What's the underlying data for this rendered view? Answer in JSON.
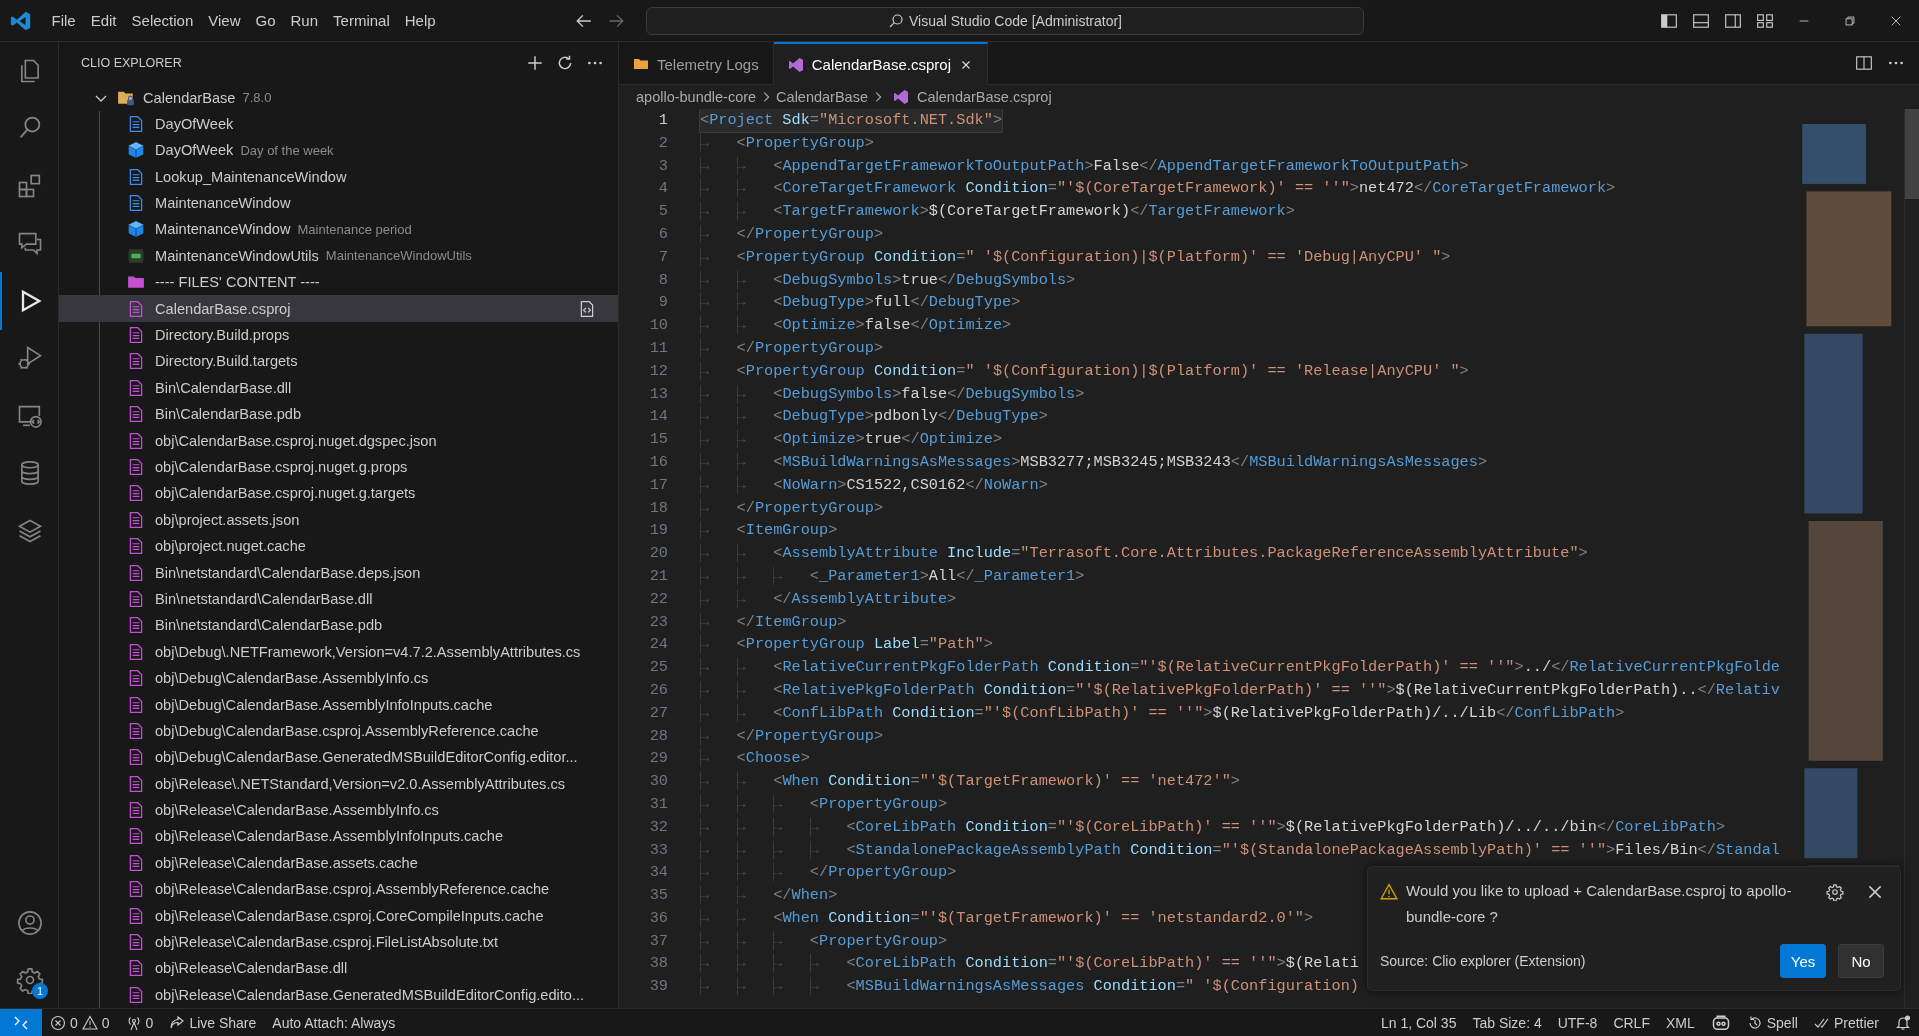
{
  "title_bar": {
    "menu": [
      "File",
      "Edit",
      "Selection",
      "View",
      "Go",
      "Run",
      "Terminal",
      "Help"
    ],
    "search": "Visual Studio Code [Administrator]"
  },
  "activity_bar": {
    "items": [
      {
        "kind": "files",
        "selected": false
      },
      {
        "kind": "search",
        "selected": false
      },
      {
        "kind": "extensions",
        "selected": false
      },
      {
        "kind": "chat",
        "selected": false
      },
      {
        "kind": "run",
        "selected": true
      },
      {
        "kind": "debug",
        "selected": false
      },
      {
        "kind": "remote",
        "selected": false
      },
      {
        "kind": "database",
        "selected": false
      },
      {
        "kind": "layers",
        "selected": false
      }
    ],
    "bottom": [
      {
        "kind": "account"
      },
      {
        "kind": "settings",
        "badge": "1"
      }
    ]
  },
  "sidebar": {
    "title": "CLIO EXPLORER",
    "tree": {
      "label": "CalendarBase",
      "description": "7.8.0",
      "expanded": true,
      "children": [
        {
          "kind": "doc",
          "label": "DayOfWeek",
          "selected": false
        },
        {
          "kind": "cube",
          "label": "DayOfWeek",
          "description": "Day of the week",
          "selected": false
        },
        {
          "kind": "doc",
          "label": "Lookup_MaintenanceWindow",
          "selected": false
        },
        {
          "kind": "doc",
          "label": "MaintenanceWindow",
          "selected": false
        },
        {
          "kind": "cube",
          "label": "MaintenanceWindow",
          "description": "Maintenance period",
          "selected": false
        },
        {
          "kind": "csharp",
          "label": "MaintenanceWindowUtils",
          "description": "MaintenanceWindowUtils",
          "selected": false
        },
        {
          "kind": "folder",
          "label": "---- FILES' CONTENT ----",
          "selected": false
        },
        {
          "kind": "file",
          "label": "CalendarBase.csproj",
          "selected": true
        },
        {
          "kind": "file",
          "label": "Directory.Build.props",
          "selected": false
        },
        {
          "kind": "file",
          "label": "Directory.Build.targets",
          "selected": false
        },
        {
          "kind": "file",
          "label": "Bin\\CalendarBase.dll",
          "selected": false
        },
        {
          "kind": "file",
          "label": "Bin\\CalendarBase.pdb",
          "selected": false
        },
        {
          "kind": "file",
          "label": "obj\\CalendarBase.csproj.nuget.dgspec.json",
          "selected": false
        },
        {
          "kind": "file",
          "label": "obj\\CalendarBase.csproj.nuget.g.props",
          "selected": false
        },
        {
          "kind": "file",
          "label": "obj\\CalendarBase.csproj.nuget.g.targets",
          "selected": false
        },
        {
          "kind": "file",
          "label": "obj\\project.assets.json",
          "selected": false
        },
        {
          "kind": "file",
          "label": "obj\\project.nuget.cache",
          "selected": false
        },
        {
          "kind": "file",
          "label": "Bin\\netstandard\\CalendarBase.deps.json",
          "selected": false
        },
        {
          "kind": "file",
          "label": "Bin\\netstandard\\CalendarBase.dll",
          "selected": false
        },
        {
          "kind": "file",
          "label": "Bin\\netstandard\\CalendarBase.pdb",
          "selected": false
        },
        {
          "kind": "file",
          "label": "obj\\Debug\\.NETFramework,Version=v4.7.2.AssemblyAttributes.cs",
          "selected": false
        },
        {
          "kind": "file",
          "label": "obj\\Debug\\CalendarBase.AssemblyInfo.cs",
          "selected": false
        },
        {
          "kind": "file",
          "label": "obj\\Debug\\CalendarBase.AssemblyInfoInputs.cache",
          "selected": false
        },
        {
          "kind": "file",
          "label": "obj\\Debug\\CalendarBase.csproj.AssemblyReference.cache",
          "selected": false
        },
        {
          "kind": "file",
          "label": "obj\\Debug\\CalendarBase.GeneratedMSBuildEditorConfig.editor...",
          "selected": false
        },
        {
          "kind": "file",
          "label": "obj\\Release\\.NETStandard,Version=v2.0.AssemblyAttributes.cs",
          "selected": false
        },
        {
          "kind": "file",
          "label": "obj\\Release\\CalendarBase.AssemblyInfo.cs",
          "selected": false
        },
        {
          "kind": "file",
          "label": "obj\\Release\\CalendarBase.AssemblyInfoInputs.cache",
          "selected": false
        },
        {
          "kind": "file",
          "label": "obj\\Release\\CalendarBase.assets.cache",
          "selected": false
        },
        {
          "kind": "file",
          "label": "obj\\Release\\CalendarBase.csproj.AssemblyReference.cache",
          "selected": false
        },
        {
          "kind": "file",
          "label": "obj\\Release\\CalendarBase.csproj.CoreCompileInputs.cache",
          "selected": false
        },
        {
          "kind": "file",
          "label": "obj\\Release\\CalendarBase.csproj.FileListAbsolute.txt",
          "selected": false
        },
        {
          "kind": "file",
          "label": "obj\\Release\\CalendarBase.dll",
          "selected": false
        },
        {
          "kind": "file",
          "label": "obj\\Release\\CalendarBase.GeneratedMSBuildEditorConfig.edito...",
          "selected": false
        }
      ]
    }
  },
  "tabs": [
    {
      "kind": "folder",
      "label": "Telemetry Logs",
      "selected": false
    },
    {
      "kind": "project",
      "label": "CalendarBase.csproj",
      "selected": true
    }
  ],
  "breadcrumbs": [
    "apollo-bundle-core",
    "CalendarBase",
    "CalendarBase.csproj"
  ],
  "editor": {
    "lines": [
      {
        "number": "1",
        "current": true,
        "tokens": [
          {
            "kind": "p",
            "text": "<"
          },
          {
            "kind": "t",
            "text": "Project"
          },
          {
            "kind": "a",
            "text": " Sdk"
          },
          {
            "kind": "p",
            "text": "="
          },
          {
            "kind": "s",
            "text": "\"Microsoft.NET.Sdk\""
          },
          {
            "kind": "p",
            "text": ">"
          }
        ]
      },
      {
        "number": "2",
        "current": false,
        "lead": "→   ",
        "tokens": [
          {
            "kind": "p",
            "text": "<"
          },
          {
            "kind": "t",
            "text": "PropertyGroup"
          },
          {
            "kind": "p",
            "text": ">"
          }
        ]
      },
      {
        "number": "3",
        "current": false,
        "lead": "→   →   ",
        "tokens": [
          {
            "kind": "p",
            "text": "<"
          },
          {
            "kind": "t",
            "text": "AppendTargetFrameworkToOutputPath"
          },
          {
            "kind": "p",
            "text": ">"
          },
          {
            "kind": "x",
            "text": "False"
          },
          {
            "kind": "p",
            "text": "</"
          },
          {
            "kind": "t",
            "text": "AppendTargetFrameworkToOutputPath"
          },
          {
            "kind": "p",
            "text": ">"
          }
        ]
      },
      {
        "number": "4",
        "current": false,
        "lead": "→   →   ",
        "tokens": [
          {
            "kind": "p",
            "text": "<"
          },
          {
            "kind": "t",
            "text": "CoreTargetFramework"
          },
          {
            "kind": "a",
            "text": " Condition"
          },
          {
            "kind": "p",
            "text": "="
          },
          {
            "kind": "s",
            "text": "\"'$(CoreTargetFramework)' == ''\""
          },
          {
            "kind": "p",
            "text": ">"
          },
          {
            "kind": "x",
            "text": "net472"
          },
          {
            "kind": "p",
            "text": "</"
          },
          {
            "kind": "t",
            "text": "CoreTargetFramework"
          },
          {
            "kind": "p",
            "text": ">"
          }
        ]
      },
      {
        "number": "5",
        "current": false,
        "lead": "→   →   ",
        "tokens": [
          {
            "kind": "p",
            "text": "<"
          },
          {
            "kind": "t",
            "text": "TargetFramework"
          },
          {
            "kind": "p",
            "text": ">"
          },
          {
            "kind": "x",
            "text": "$(CoreTargetFramework)"
          },
          {
            "kind": "p",
            "text": "</"
          },
          {
            "kind": "t",
            "text": "TargetFramework"
          },
          {
            "kind": "p",
            "text": ">"
          }
        ]
      },
      {
        "number": "6",
        "current": false,
        "lead": "→   ",
        "tokens": [
          {
            "kind": "p",
            "text": "</"
          },
          {
            "kind": "t",
            "text": "PropertyGroup"
          },
          {
            "kind": "p",
            "text": ">"
          }
        ]
      },
      {
        "number": "7",
        "current": false,
        "lead": "→   ",
        "tokens": [
          {
            "kind": "p",
            "text": "<"
          },
          {
            "kind": "t",
            "text": "PropertyGroup"
          },
          {
            "kind": "a",
            "text": " Condition"
          },
          {
            "kind": "p",
            "text": "="
          },
          {
            "kind": "s",
            "text": "\" '$(Configuration)|$(Platform)' == 'Debug|AnyCPU' \""
          },
          {
            "kind": "p",
            "text": ">"
          }
        ]
      },
      {
        "number": "8",
        "current": false,
        "lead": "→   →   ",
        "tokens": [
          {
            "kind": "p",
            "text": "<"
          },
          {
            "kind": "t",
            "text": "DebugSymbols"
          },
          {
            "kind": "p",
            "text": ">"
          },
          {
            "kind": "x",
            "text": "true"
          },
          {
            "kind": "p",
            "text": "</"
          },
          {
            "kind": "t",
            "text": "DebugSymbols"
          },
          {
            "kind": "p",
            "text": ">"
          }
        ]
      },
      {
        "number": "9",
        "current": false,
        "lead": "→   →   ",
        "tokens": [
          {
            "kind": "p",
            "text": "<"
          },
          {
            "kind": "t",
            "text": "DebugType"
          },
          {
            "kind": "p",
            "text": ">"
          },
          {
            "kind": "x",
            "text": "full"
          },
          {
            "kind": "p",
            "text": "</"
          },
          {
            "kind": "t",
            "text": "DebugType"
          },
          {
            "kind": "p",
            "text": ">"
          }
        ]
      },
      {
        "number": "10",
        "current": false,
        "lead": "→   →   ",
        "tokens": [
          {
            "kind": "p",
            "text": "<"
          },
          {
            "kind": "t",
            "text": "Optimize"
          },
          {
            "kind": "p",
            "text": ">"
          },
          {
            "kind": "x",
            "text": "false"
          },
          {
            "kind": "p",
            "text": "</"
          },
          {
            "kind": "t",
            "text": "Optimize"
          },
          {
            "kind": "p",
            "text": ">"
          }
        ]
      },
      {
        "number": "11",
        "current": false,
        "lead": "→   ",
        "tokens": [
          {
            "kind": "p",
            "text": "</"
          },
          {
            "kind": "t",
            "text": "PropertyGroup"
          },
          {
            "kind": "p",
            "text": ">"
          }
        ]
      },
      {
        "number": "12",
        "current": false,
        "lead": "→   ",
        "tokens": [
          {
            "kind": "p",
            "text": "<"
          },
          {
            "kind": "t",
            "text": "PropertyGroup"
          },
          {
            "kind": "a",
            "text": " Condition"
          },
          {
            "kind": "p",
            "text": "="
          },
          {
            "kind": "s",
            "text": "\" '$(Configuration)|$(Platform)' == 'Release|AnyCPU' \""
          },
          {
            "kind": "p",
            "text": ">"
          }
        ]
      },
      {
        "number": "13",
        "current": false,
        "lead": "→   →   ",
        "tokens": [
          {
            "kind": "p",
            "text": "<"
          },
          {
            "kind": "t",
            "text": "DebugSymbols"
          },
          {
            "kind": "p",
            "text": ">"
          },
          {
            "kind": "x",
            "text": "false"
          },
          {
            "kind": "p",
            "text": "</"
          },
          {
            "kind": "t",
            "text": "DebugSymbols"
          },
          {
            "kind": "p",
            "text": ">"
          }
        ]
      },
      {
        "number": "14",
        "current": false,
        "lead": "→   →   ",
        "tokens": [
          {
            "kind": "p",
            "text": "<"
          },
          {
            "kind": "t",
            "text": "DebugType"
          },
          {
            "kind": "p",
            "text": ">"
          },
          {
            "kind": "x",
            "text": "pdbonly"
          },
          {
            "kind": "p",
            "text": "</"
          },
          {
            "kind": "t",
            "text": "DebugType"
          },
          {
            "kind": "p",
            "text": ">"
          }
        ]
      },
      {
        "number": "15",
        "current": false,
        "lead": "→   →   ",
        "tokens": [
          {
            "kind": "p",
            "text": "<"
          },
          {
            "kind": "t",
            "text": "Optimize"
          },
          {
            "kind": "p",
            "text": ">"
          },
          {
            "kind": "x",
            "text": "true"
          },
          {
            "kind": "p",
            "text": "</"
          },
          {
            "kind": "t",
            "text": "Optimize"
          },
          {
            "kind": "p",
            "text": ">"
          }
        ]
      },
      {
        "number": "16",
        "current": false,
        "lead": "→   →   ",
        "tokens": [
          {
            "kind": "p",
            "text": "<"
          },
          {
            "kind": "t",
            "text": "MSBuildWarningsAsMessages"
          },
          {
            "kind": "p",
            "text": ">"
          },
          {
            "kind": "x",
            "text": "MSB3277;MSB3245;MSB3243"
          },
          {
            "kind": "p",
            "text": "</"
          },
          {
            "kind": "t",
            "text": "MSBuildWarningsAsMessages"
          },
          {
            "kind": "p",
            "text": ">"
          }
        ]
      },
      {
        "number": "17",
        "current": false,
        "lead": "→   →   ",
        "tokens": [
          {
            "kind": "p",
            "text": "<"
          },
          {
            "kind": "t",
            "text": "NoWarn"
          },
          {
            "kind": "p",
            "text": ">"
          },
          {
            "kind": "x",
            "text": "CS1522,CS0162"
          },
          {
            "kind": "p",
            "text": "</"
          },
          {
            "kind": "t",
            "text": "NoWarn"
          },
          {
            "kind": "p",
            "text": ">"
          }
        ]
      },
      {
        "number": "18",
        "current": false,
        "lead": "→   ",
        "tokens": [
          {
            "kind": "p",
            "text": "</"
          },
          {
            "kind": "t",
            "text": "PropertyGroup"
          },
          {
            "kind": "p",
            "text": ">"
          }
        ]
      },
      {
        "number": "19",
        "current": false,
        "lead": "→   ",
        "tokens": [
          {
            "kind": "p",
            "text": "<"
          },
          {
            "kind": "t",
            "text": "ItemGroup"
          },
          {
            "kind": "p",
            "text": ">"
          }
        ]
      },
      {
        "number": "20",
        "current": false,
        "lead": "→   →   ",
        "tokens": [
          {
            "kind": "p",
            "text": "<"
          },
          {
            "kind": "t",
            "text": "AssemblyAttribute"
          },
          {
            "kind": "a",
            "text": " Include"
          },
          {
            "kind": "p",
            "text": "="
          },
          {
            "kind": "s",
            "text": "\"Terrasoft.Core.Attributes.PackageReferenceAssemblyAttribute\""
          },
          {
            "kind": "p",
            "text": ">"
          }
        ]
      },
      {
        "number": "21",
        "current": false,
        "lead": "→   →   →   ",
        "tokens": [
          {
            "kind": "p",
            "text": "<"
          },
          {
            "kind": "t",
            "text": "_Parameter1"
          },
          {
            "kind": "p",
            "text": ">"
          },
          {
            "kind": "x",
            "text": "All"
          },
          {
            "kind": "p",
            "text": "</"
          },
          {
            "kind": "t",
            "text": "_Parameter1"
          },
          {
            "kind": "p",
            "text": ">"
          }
        ]
      },
      {
        "number": "22",
        "current": false,
        "lead": "→   →   ",
        "tokens": [
          {
            "kind": "p",
            "text": "</"
          },
          {
            "kind": "t",
            "text": "AssemblyAttribute"
          },
          {
            "kind": "p",
            "text": ">"
          }
        ]
      },
      {
        "number": "23",
        "current": false,
        "lead": "→   ",
        "tokens": [
          {
            "kind": "p",
            "text": "</"
          },
          {
            "kind": "t",
            "text": "ItemGroup"
          },
          {
            "kind": "p",
            "text": ">"
          }
        ]
      },
      {
        "number": "24",
        "current": false,
        "lead": "→   ",
        "tokens": [
          {
            "kind": "p",
            "text": "<"
          },
          {
            "kind": "t",
            "text": "PropertyGroup"
          },
          {
            "kind": "a",
            "text": " Label"
          },
          {
            "kind": "p",
            "text": "="
          },
          {
            "kind": "s",
            "text": "\"Path\""
          },
          {
            "kind": "p",
            "text": ">"
          }
        ]
      },
      {
        "number": "25",
        "current": false,
        "lead": "→   →   ",
        "tokens": [
          {
            "kind": "p",
            "text": "<"
          },
          {
            "kind": "t",
            "text": "RelativeCurrentPkgFolderPath"
          },
          {
            "kind": "a",
            "text": " Condition"
          },
          {
            "kind": "p",
            "text": "="
          },
          {
            "kind": "s",
            "text": "\"'$(RelativeCurrentPkgFolderPath)' == ''\""
          },
          {
            "kind": "p",
            "text": ">"
          },
          {
            "kind": "x",
            "text": "../"
          },
          {
            "kind": "p",
            "text": "</"
          },
          {
            "kind": "t",
            "text": "RelativeCurrentPkgFolde"
          }
        ]
      },
      {
        "number": "26",
        "current": false,
        "lead": "→   →   ",
        "tokens": [
          {
            "kind": "p",
            "text": "<"
          },
          {
            "kind": "t",
            "text": "RelativePkgFolderPath"
          },
          {
            "kind": "a",
            "text": " Condition"
          },
          {
            "kind": "p",
            "text": "="
          },
          {
            "kind": "s",
            "text": "\"'$(RelativePkgFolderPath)' == ''\""
          },
          {
            "kind": "p",
            "text": ">"
          },
          {
            "kind": "x",
            "text": "$(RelativeCurrentPkgFolderPath).."
          },
          {
            "kind": "p",
            "text": "</"
          },
          {
            "kind": "t",
            "text": "Relativ"
          }
        ]
      },
      {
        "number": "27",
        "current": false,
        "lead": "→   →   ",
        "tokens": [
          {
            "kind": "p",
            "text": "<"
          },
          {
            "kind": "t",
            "text": "ConfLibPath"
          },
          {
            "kind": "a",
            "text": " Condition"
          },
          {
            "kind": "p",
            "text": "="
          },
          {
            "kind": "s",
            "text": "\"'$(ConfLibPath)' == ''\""
          },
          {
            "kind": "p",
            "text": ">"
          },
          {
            "kind": "x",
            "text": "$(RelativePkgFolderPath)/../Lib"
          },
          {
            "kind": "p",
            "text": "</"
          },
          {
            "kind": "t",
            "text": "ConfLibPath"
          },
          {
            "kind": "p",
            "text": ">"
          }
        ]
      },
      {
        "number": "28",
        "current": false,
        "lead": "→   ",
        "tokens": [
          {
            "kind": "p",
            "text": "</"
          },
          {
            "kind": "t",
            "text": "PropertyGroup"
          },
          {
            "kind": "p",
            "text": ">"
          }
        ]
      },
      {
        "number": "29",
        "current": false,
        "lead": "→   ",
        "tokens": [
          {
            "kind": "p",
            "text": "<"
          },
          {
            "kind": "t",
            "text": "Choose"
          },
          {
            "kind": "p",
            "text": ">"
          }
        ]
      },
      {
        "number": "30",
        "current": false,
        "lead": "→   →   ",
        "tokens": [
          {
            "kind": "p",
            "text": "<"
          },
          {
            "kind": "t",
            "text": "When"
          },
          {
            "kind": "a",
            "text": " Condition"
          },
          {
            "kind": "p",
            "text": "="
          },
          {
            "kind": "s",
            "text": "\"'$(TargetFramework)' == 'net472'\""
          },
          {
            "kind": "p",
            "text": ">"
          }
        ]
      },
      {
        "number": "31",
        "current": false,
        "lead": "→   →   →   ",
        "tokens": [
          {
            "kind": "p",
            "text": "<"
          },
          {
            "kind": "t",
            "text": "PropertyGroup"
          },
          {
            "kind": "p",
            "text": ">"
          }
        ]
      },
      {
        "number": "32",
        "current": false,
        "lead": "→   →   →   →   ",
        "tokens": [
          {
            "kind": "p",
            "text": "<"
          },
          {
            "kind": "t",
            "text": "CoreLibPath"
          },
          {
            "kind": "a",
            "text": " Condition"
          },
          {
            "kind": "p",
            "text": "="
          },
          {
            "kind": "s",
            "text": "\"'$(CoreLibPath)' == ''\""
          },
          {
            "kind": "p",
            "text": ">"
          },
          {
            "kind": "x",
            "text": "$(RelativePkgFolderPath)/../../bin"
          },
          {
            "kind": "p",
            "text": "</"
          },
          {
            "kind": "t",
            "text": "CoreLibPath"
          },
          {
            "kind": "p",
            "text": ">"
          }
        ]
      },
      {
        "number": "33",
        "current": false,
        "lead": "→   →   →   →   ",
        "tokens": [
          {
            "kind": "p",
            "text": "<"
          },
          {
            "kind": "t",
            "text": "StandalonePackageAssemblyPath"
          },
          {
            "kind": "a",
            "text": " Condition"
          },
          {
            "kind": "p",
            "text": "="
          },
          {
            "kind": "s",
            "text": "\"'$(StandalonePackageAssemblyPath)' == ''\""
          },
          {
            "kind": "p",
            "text": ">"
          },
          {
            "kind": "x",
            "text": "Files/Bin"
          },
          {
            "kind": "p",
            "text": "</"
          },
          {
            "kind": "t",
            "text": "Standal"
          }
        ]
      },
      {
        "number": "34",
        "current": false,
        "lead": "→   →   →   ",
        "tokens": [
          {
            "kind": "p",
            "text": "</"
          },
          {
            "kind": "t",
            "text": "PropertyGroup"
          },
          {
            "kind": "p",
            "text": ">"
          }
        ]
      },
      {
        "number": "35",
        "current": false,
        "lead": "→   →   ",
        "tokens": [
          {
            "kind": "p",
            "text": "</"
          },
          {
            "kind": "t",
            "text": "When"
          },
          {
            "kind": "p",
            "text": ">"
          }
        ]
      },
      {
        "number": "36",
        "current": false,
        "lead": "→   →   ",
        "tokens": [
          {
            "kind": "p",
            "text": "<"
          },
          {
            "kind": "t",
            "text": "When"
          },
          {
            "kind": "a",
            "text": " Condition"
          },
          {
            "kind": "p",
            "text": "="
          },
          {
            "kind": "s",
            "text": "\"'$(TargetFramework)' == 'netstandard2.0'\""
          },
          {
            "kind": "p",
            "text": ">"
          }
        ]
      },
      {
        "number": "37",
        "current": false,
        "lead": "→   →   →   ",
        "tokens": [
          {
            "kind": "p",
            "text": "<"
          },
          {
            "kind": "t",
            "text": "PropertyGroup"
          },
          {
            "kind": "p",
            "text": ">"
          }
        ]
      },
      {
        "number": "38",
        "current": false,
        "lead": "→   →   →   →   ",
        "tokens": [
          {
            "kind": "p",
            "text": "<"
          },
          {
            "kind": "t",
            "text": "CoreLibPath"
          },
          {
            "kind": "a",
            "text": " Condition"
          },
          {
            "kind": "p",
            "text": "="
          },
          {
            "kind": "s",
            "text": "\"'$(CoreLibPath)' == ''\""
          },
          {
            "kind": "p",
            "text": ">"
          },
          {
            "kind": "x",
            "text": "$(Relati"
          }
        ]
      },
      {
        "number": "39",
        "current": false,
        "lead": "→   →   →   →   ",
        "tokens": [
          {
            "kind": "p",
            "text": "<"
          },
          {
            "kind": "t",
            "text": "MSBuildWarningsAsMessages"
          },
          {
            "kind": "a",
            "text": " Condition"
          },
          {
            "kind": "p",
            "text": "="
          },
          {
            "kind": "s",
            "text": "\" '$(Configuration)"
          }
        ]
      }
    ]
  },
  "notification": {
    "message": "Would you like to upload + CalendarBase.csproj to apollo-bundle-core ?",
    "source": "Source: Clio explorer (Extension)",
    "buttons": [
      {
        "label": "Yes",
        "primary": true
      },
      {
        "label": "No",
        "primary": false
      }
    ]
  },
  "status_bar": {
    "left": [
      {
        "kind": "remote"
      },
      {
        "kind": "problems",
        "errors": "0",
        "warnings": "0"
      },
      {
        "kind": "ports",
        "text": "0"
      },
      {
        "kind": "liveshare",
        "text": "Live Share"
      },
      {
        "kind": "plain",
        "text": "Auto Attach: Always"
      }
    ],
    "right": [
      {
        "kind": "plain",
        "text": "Ln 1, Col 35"
      },
      {
        "kind": "plain",
        "text": "Tab Size: 4"
      },
      {
        "kind": "plain",
        "text": "UTF-8"
      },
      {
        "kind": "plain",
        "text": "CRLF"
      },
      {
        "kind": "plain",
        "text": "XML"
      },
      {
        "kind": "copilot"
      },
      {
        "kind": "spell",
        "text": "Spell"
      },
      {
        "kind": "prettier",
        "text": "Prettier"
      },
      {
        "kind": "bell"
      }
    ]
  }
}
